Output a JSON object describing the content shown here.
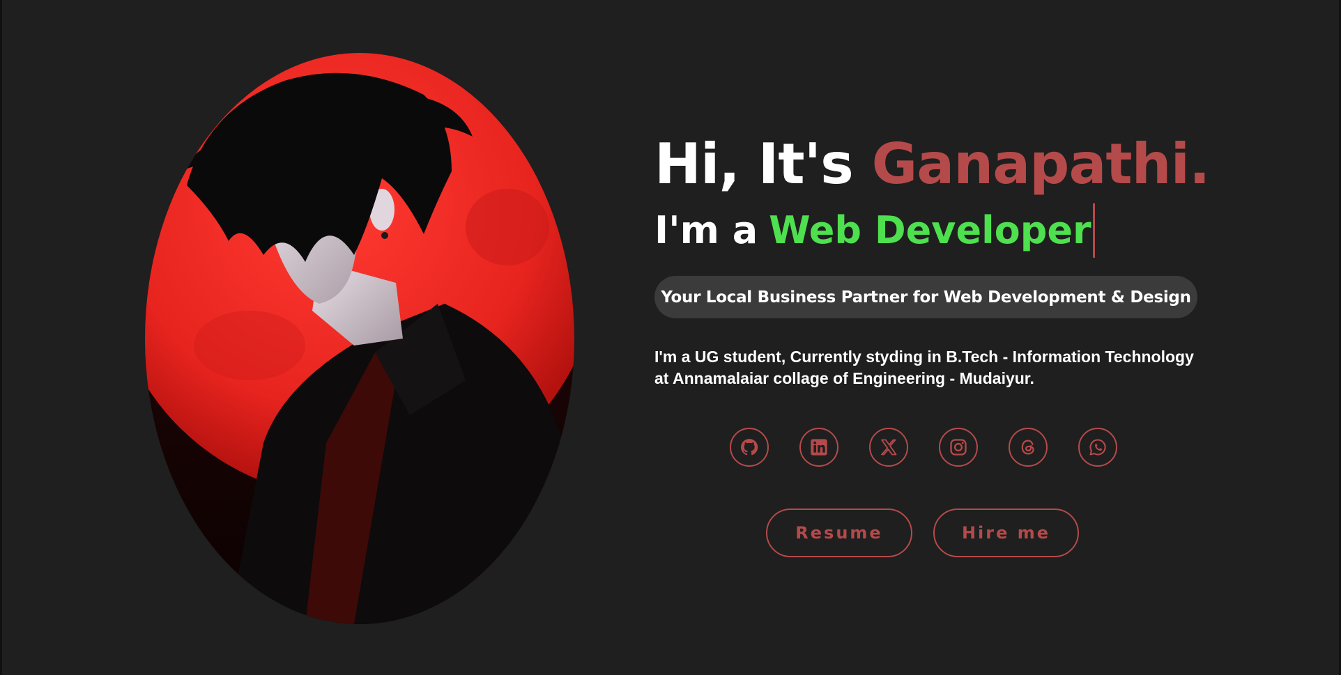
{
  "hero": {
    "greeting_prefix": "Hi, It's",
    "name": "Ganapathi.",
    "role_prefix": "I'm a",
    "role_typed": "Web Developer",
    "tagline": "Your Local Business Partner for Web Development & Design",
    "intro_line1": "I'm a UG student, Currently styding in B.Tech - Information Technology",
    "intro_line2": "at Annamalaiar collage of Engineering - Mudaiyur."
  },
  "socials": [
    {
      "icon": "github-icon"
    },
    {
      "icon": "linkedin-icon"
    },
    {
      "icon": "x-icon"
    },
    {
      "icon": "instagram-icon"
    },
    {
      "icon": "threads-icon"
    },
    {
      "icon": "whatsapp-icon"
    }
  ],
  "actions": {
    "resume_label": "Resume",
    "hire_label": "Hire me"
  },
  "colors": {
    "background": "#1f1f1f",
    "accent": "#b54a4a",
    "highlight": "#4ee04e",
    "pill": "#3b3b3c",
    "text": "#ffffff"
  },
  "portrait": {
    "subject": "anime-style young man in black suit against a red moon"
  }
}
